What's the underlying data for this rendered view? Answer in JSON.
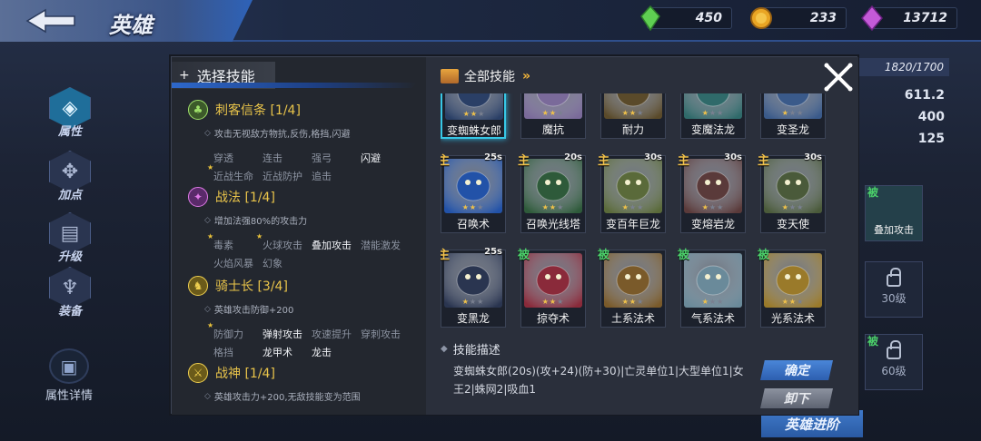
{
  "topbar": {
    "title": "英雄",
    "resources": [
      {
        "icon": "green-crystal-icon",
        "value": "450"
      },
      {
        "icon": "gold-coin-icon",
        "value": "233"
      },
      {
        "icon": "purple-gem-icon",
        "value": "13712"
      }
    ]
  },
  "nav": {
    "items": [
      {
        "label": "属性"
      },
      {
        "label": "加点"
      },
      {
        "label": "升级"
      },
      {
        "label": "装备"
      }
    ],
    "detail_label": "属性详情"
  },
  "behind": {
    "exp": "1820/1700",
    "stats": [
      "611.2",
      "400",
      "125"
    ],
    "slot_skill_label": "叠加攻击",
    "slot_skill_tag": "被",
    "lock1": "30级",
    "lock2": "60级",
    "lock2_tag": "被",
    "hero_button": "英雄进阶"
  },
  "modal": {
    "left_title": "选择技能",
    "branches": [
      {
        "name": "刺客信条",
        "progress": "[1/4]",
        "desc": "攻击无视敌方物抗,反伤,格挡,闪避",
        "skills": [
          {
            "t": "穿透",
            "on": false,
            "star": false
          },
          {
            "t": "连击",
            "on": false,
            "star": false
          },
          {
            "t": "强弓",
            "on": false,
            "star": false
          },
          {
            "t": "闪避",
            "on": true,
            "star": false
          },
          {
            "t": "近战生命",
            "on": false,
            "star": true
          },
          {
            "t": "近战防护",
            "on": false,
            "star": false
          },
          {
            "t": "追击",
            "on": false,
            "star": false
          }
        ]
      },
      {
        "name": "战法",
        "progress": "[1/4]",
        "desc": "增加法强80%的攻击力",
        "skills": [
          {
            "t": "毒素",
            "on": false,
            "star": true
          },
          {
            "t": "火球攻击",
            "on": false,
            "star": true
          },
          {
            "t": "叠加攻击",
            "on": true,
            "star": false
          },
          {
            "t": "潜能激发",
            "on": false,
            "star": false
          },
          {
            "t": "火焰风暴",
            "on": false,
            "star": false
          },
          {
            "t": "幻象",
            "on": false,
            "star": false
          }
        ]
      },
      {
        "name": "骑士长",
        "progress": "[3/4]",
        "desc": "英雄攻击防御+200",
        "skills": [
          {
            "t": "防御力",
            "on": false,
            "star": true
          },
          {
            "t": "弹射攻击",
            "on": true,
            "star": false
          },
          {
            "t": "攻速提升",
            "on": false,
            "star": false
          },
          {
            "t": "穿刺攻击",
            "on": false,
            "star": false
          },
          {
            "t": "格挡",
            "on": false,
            "star": false
          },
          {
            "t": "龙甲术",
            "on": true,
            "star": false
          },
          {
            "t": "龙击",
            "on": true,
            "star": false
          }
        ]
      },
      {
        "name": "战神",
        "progress": "[1/4]",
        "desc": "英雄攻击力+200,无敌技能变为范围",
        "skills": []
      }
    ],
    "right_title": "全部技能",
    "cards": [
      {
        "name": "变蜘蛛女郎",
        "stars": 2,
        "tag": "",
        "cd": "",
        "selected": true,
        "color": "#2a3f66"
      },
      {
        "name": "魔抗",
        "stars": 2,
        "tag": "",
        "cd": "",
        "selected": false,
        "color": "#7a6a9a"
      },
      {
        "name": "耐力",
        "stars": 2,
        "tag": "",
        "cd": "",
        "selected": false,
        "color": "#5a4a2a"
      },
      {
        "name": "变魔法龙",
        "stars": 1,
        "tag": "",
        "cd": "",
        "selected": false,
        "color": "#2f6a6a"
      },
      {
        "name": "变圣龙",
        "stars": 1,
        "tag": "",
        "cd": "",
        "selected": false,
        "color": "#3a5a8a"
      },
      {
        "name": "召唤术",
        "stars": 2,
        "tag": "主",
        "cd": "25s",
        "selected": false,
        "color": "#2252a8"
      },
      {
        "name": "召唤光线塔",
        "stars": 2,
        "tag": "主",
        "cd": "20s",
        "selected": false,
        "color": "#2e5a3a"
      },
      {
        "name": "变百年巨龙",
        "stars": 1,
        "tag": "主",
        "cd": "30s",
        "selected": false,
        "color": "#5a6a3a"
      },
      {
        "name": "变熔岩龙",
        "stars": 1,
        "tag": "主",
        "cd": "30s",
        "selected": false,
        "color": "#5a3a3a"
      },
      {
        "name": "变天使",
        "stars": 1,
        "tag": "主",
        "cd": "30s",
        "selected": false,
        "color": "#4a5a3a"
      },
      {
        "name": "变黑龙",
        "stars": 1,
        "tag": "主",
        "cd": "25s",
        "selected": false,
        "color": "#2a3550"
      },
      {
        "name": "掠夺术",
        "stars": 2,
        "tag": "被",
        "cd": "",
        "selected": false,
        "color": "#8a2a3a"
      },
      {
        "name": "土系法术",
        "stars": 2,
        "tag": "被",
        "cd": "",
        "selected": false,
        "color": "#7a5a2a"
      },
      {
        "name": "气系法术",
        "stars": 1,
        "tag": "被",
        "cd": "",
        "selected": false,
        "color": "#6a8a9a"
      },
      {
        "name": "光系法术",
        "stars": 2,
        "tag": "被",
        "cd": "",
        "selected": false,
        "color": "#9a7a2a"
      }
    ],
    "desc_title": "技能描述",
    "desc_text": "变蜘蛛女郎(20s)(攻+24)(防+30)|亡灵单位1|大型单位1|女王2|蛛网2|吸血1",
    "confirm": "确定",
    "unload": "卸下"
  }
}
